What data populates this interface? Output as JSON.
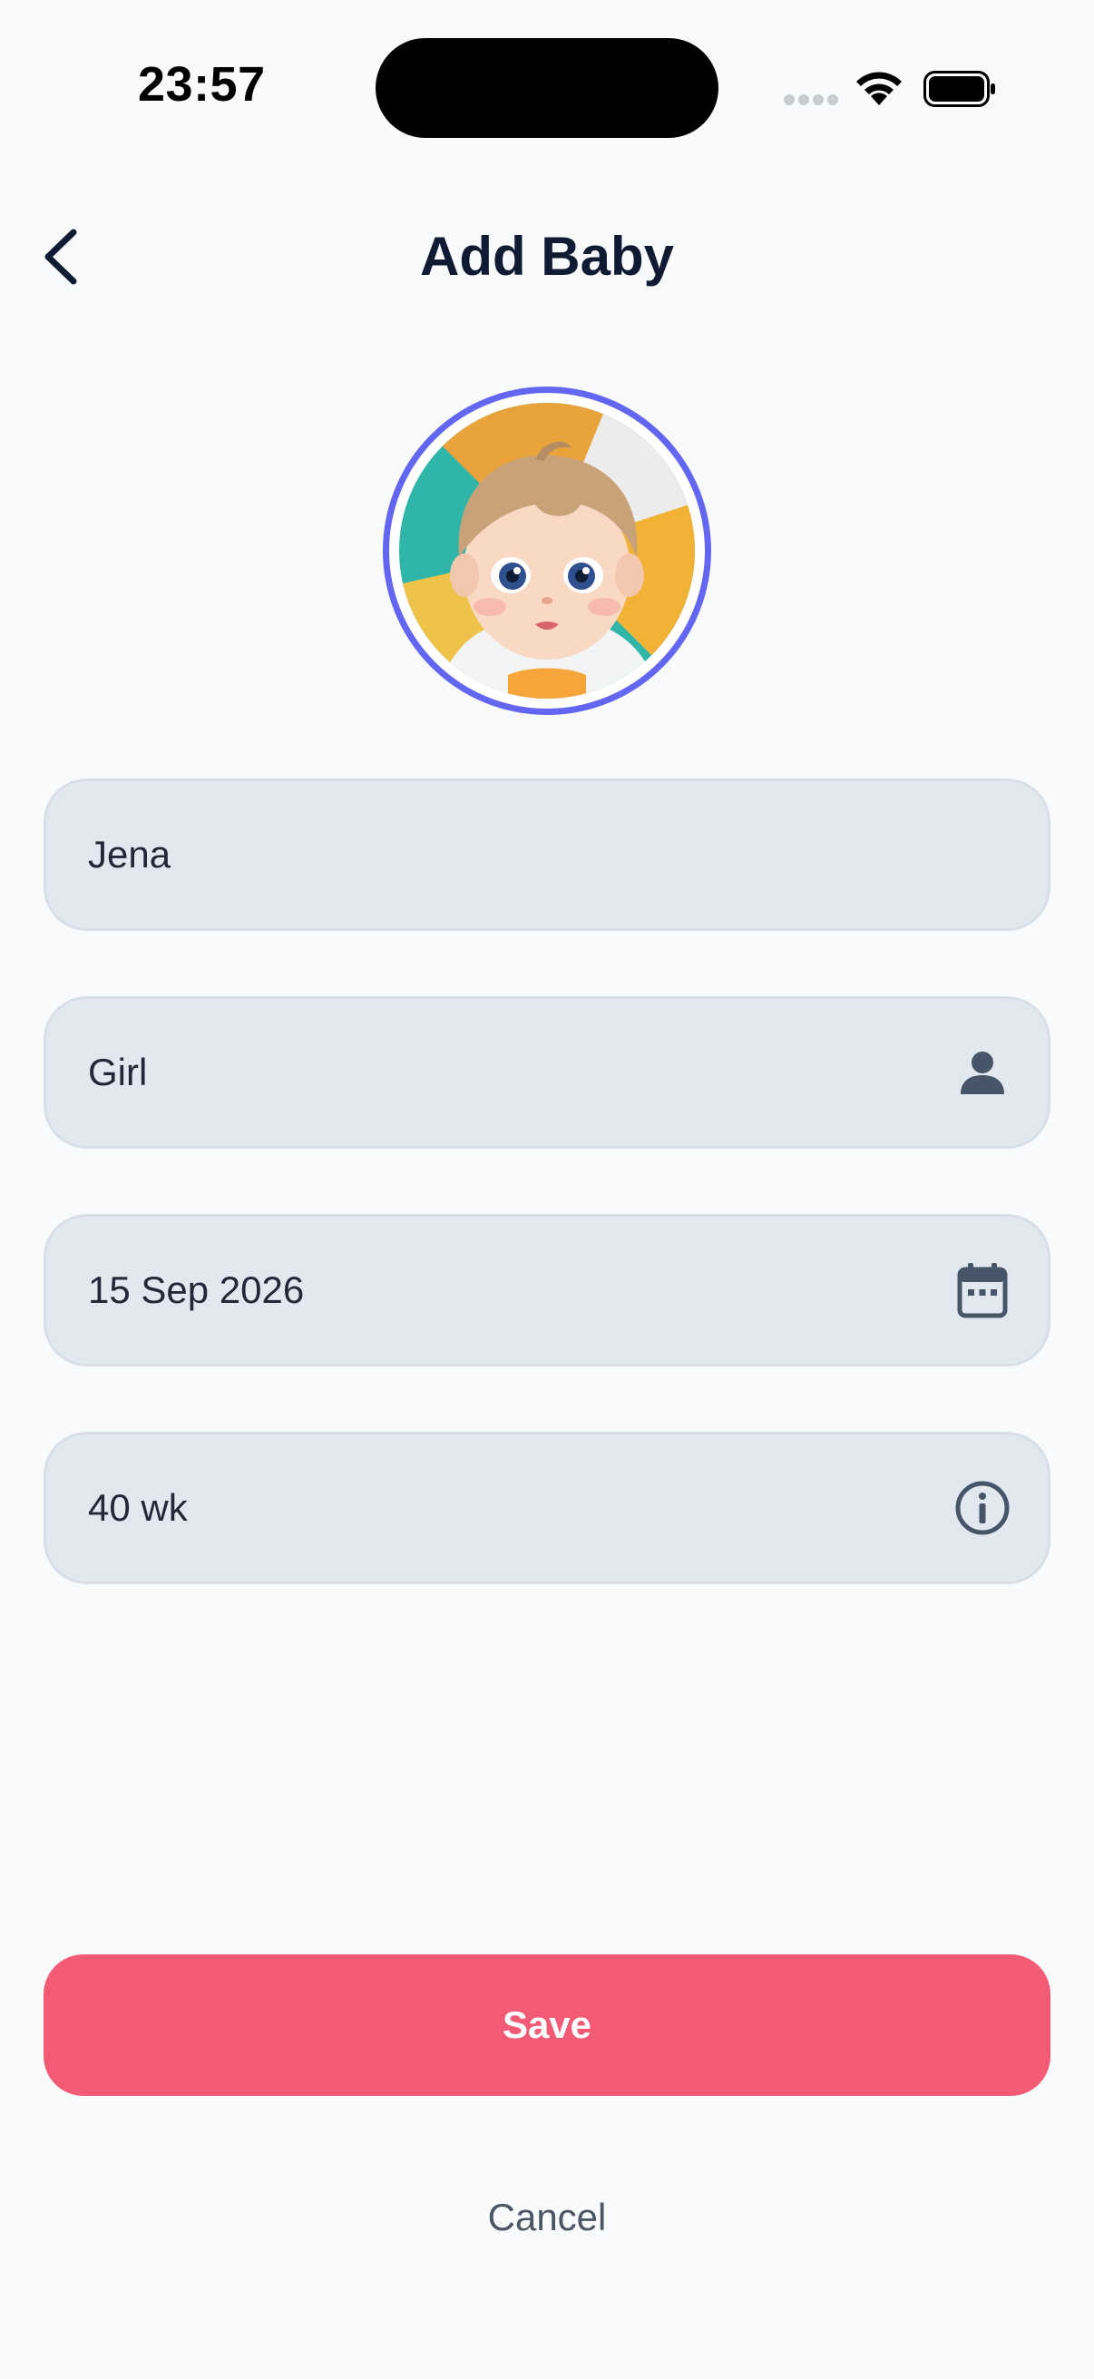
{
  "status_bar": {
    "time": "23:57"
  },
  "header": {
    "title": "Add Baby",
    "back_icon": "chevron-left-icon"
  },
  "avatar": {
    "description_icon": "baby-avatar",
    "ring_color": "#6366F1"
  },
  "form": {
    "name": {
      "value": "Jena"
    },
    "gender": {
      "value": "Girl",
      "icon": "person-icon"
    },
    "birth_date": {
      "value": "15 Sep 2026",
      "icon": "calendar-icon"
    },
    "gestational_age": {
      "value": "40 wk",
      "icon": "info-icon"
    }
  },
  "actions": {
    "save_label": "Save",
    "cancel_label": "Cancel",
    "save_color": "#F25A75"
  }
}
